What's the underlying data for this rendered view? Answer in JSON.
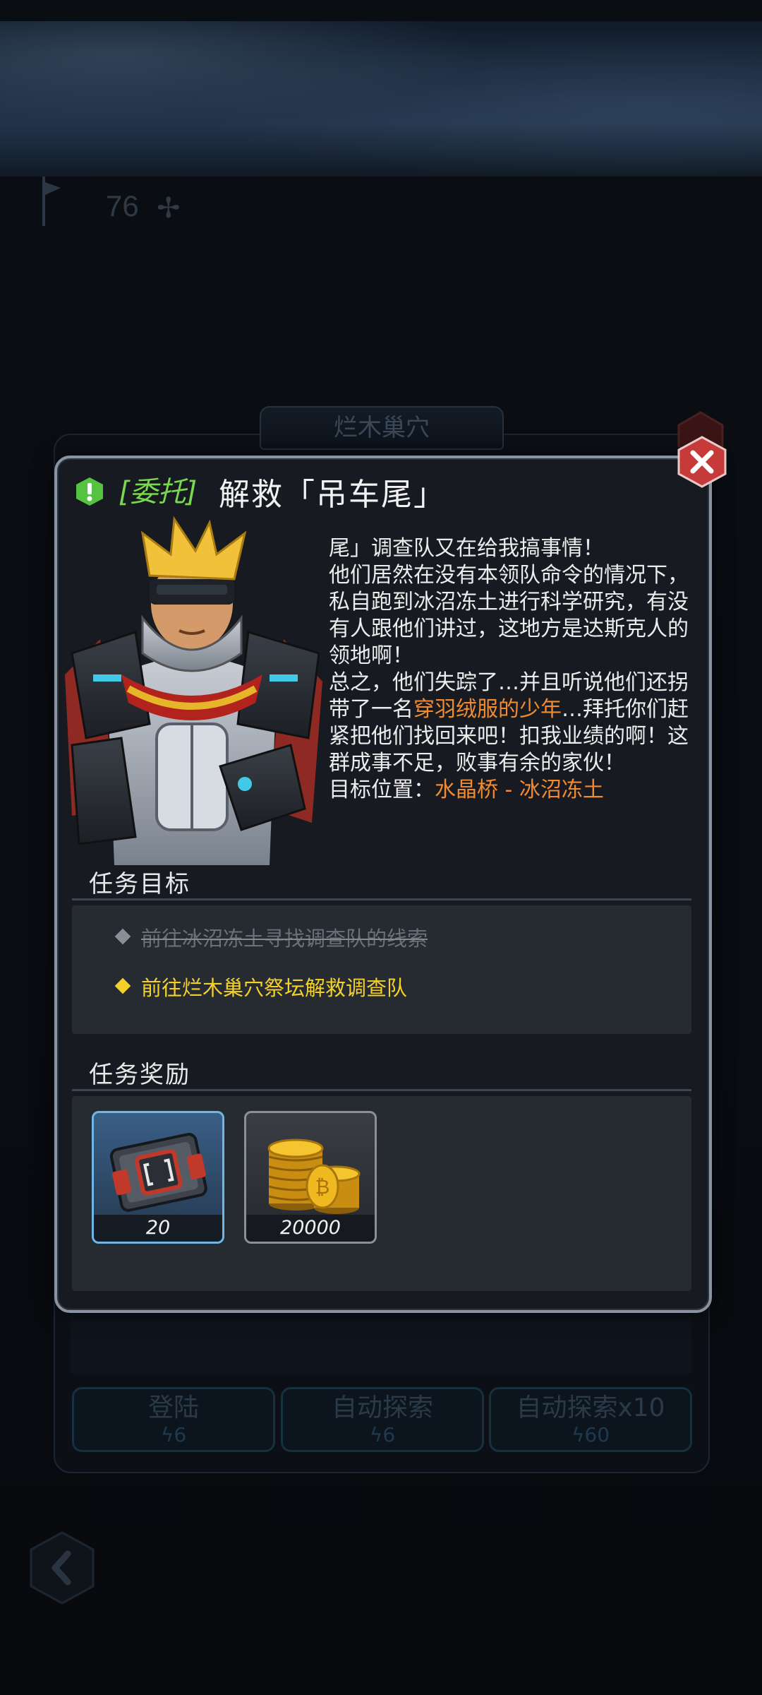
{
  "background": {
    "level_value": "76",
    "map_title": "烂木巢穴",
    "buttons": [
      {
        "label": "登陆",
        "cost": "6"
      },
      {
        "label": "自动探索",
        "cost": "6"
      },
      {
        "label": "自动探索x10",
        "cost": "60"
      }
    ]
  },
  "dialog": {
    "tag": "[委托]",
    "title": "解救「吊车尾」",
    "story": {
      "p1": "尾」调查队又在给我搞事情！",
      "p2": "他们居然在没有本领队命令的情况下，私自跑到冰沼冻土进行科学研究，有没有人跟他们讲过，这地方是达斯克人的领地啊！",
      "p3_before": "总之，他们失踪了…并且听说他们还拐带了一名",
      "p3_highlight": "穿羽绒服的少年",
      "p3_after": "…拜托你们赶紧把他们找回来吧！扣我业绩的啊！这群成事不足，败事有余的家伙！",
      "location_label": "目标位置：",
      "location_value": "水晶桥  -  冰沼冻土"
    },
    "objectives_title": "任务目标",
    "objectives": [
      {
        "text": "前往冰沼冻土寻找调查队的线索",
        "state": "done"
      },
      {
        "text": "前往烂木巢穴祭坛解救调查队",
        "state": "active"
      }
    ],
    "rewards_title": "任务奖励",
    "rewards": [
      {
        "icon": "gear-box-icon",
        "count": "20"
      },
      {
        "icon": "gold-coins-icon",
        "count": "20000"
      }
    ]
  },
  "colors": {
    "accent_green": "#79d84d",
    "highlight_orange": "#f28a2f",
    "active_yellow": "#f3d12a",
    "close_red": "#c73a3a"
  }
}
